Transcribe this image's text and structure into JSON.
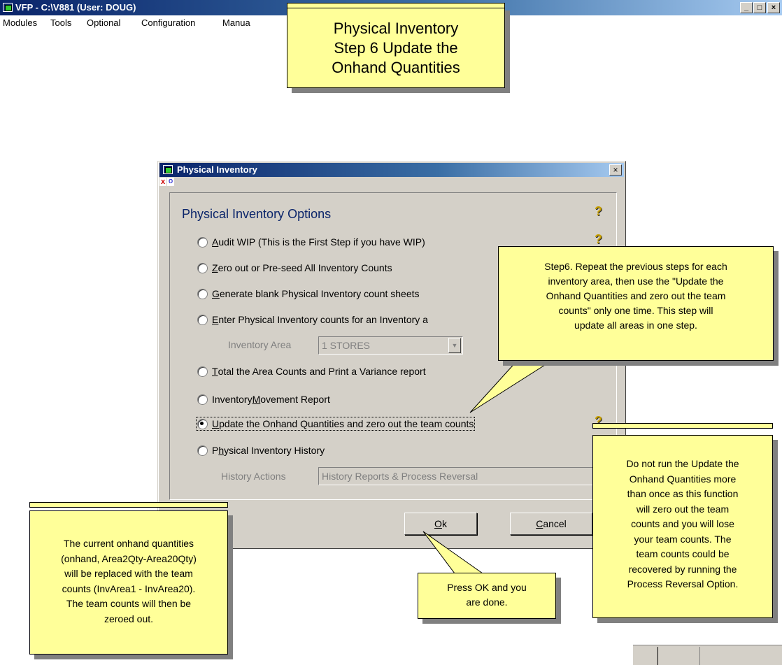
{
  "main_window": {
    "title": "VFP - C:\\V881  (User: DOUG)",
    "controls": [
      "_",
      "□",
      "×"
    ]
  },
  "menu": [
    "Modules",
    "Tools",
    "Optional",
    "Configuration",
    "Manua"
  ],
  "title_callout": {
    "line1": "Physical Inventory",
    "line2": "Step 6 Update the",
    "line3": "Onhand Quantities"
  },
  "dialog": {
    "title": "Physical Inventory",
    "close_label": "×",
    "toolbar": [
      "x",
      "o"
    ],
    "heading": "Physical Inventory Options",
    "help_glyph": "?",
    "options": [
      {
        "pre": "",
        "key": "A",
        "post": "udit WIP (This is the First Step if you have WIP)",
        "selected": false
      },
      {
        "pre": "",
        "key": "Z",
        "post": "ero out or Pre-seed All Inventory Counts",
        "selected": false
      },
      {
        "pre": "",
        "key": "G",
        "post": "enerate blank Physical Inventory count sheets",
        "selected": false
      },
      {
        "pre": "",
        "key": "E",
        "post": "nter Physical Inventory counts for an Inventory a",
        "selected": false
      },
      {
        "pre": "",
        "key": "T",
        "post": "otal the Area Counts and Print a Variance report",
        "selected": false
      },
      {
        "pre": "Inventory ",
        "key": "M",
        "post": "ovement Report",
        "selected": false
      },
      {
        "pre": "",
        "key": "U",
        "post": "pdate the Onhand Quantities and zero out the team counts",
        "selected": true
      },
      {
        "pre": "P",
        "key": "h",
        "post": "ysical Inventory History",
        "selected": false
      }
    ],
    "inventory_area": {
      "label": "Inventory Area",
      "value": "1  STORES"
    },
    "history_actions": {
      "label": "History Actions",
      "value": "History Reports & Process Reversal"
    },
    "ok": {
      "key": "O",
      "rest": "k"
    },
    "cancel": {
      "key": "C",
      "rest": "ancel"
    }
  },
  "callouts": {
    "step6": [
      "Step6. Repeat the previous steps for each",
      "inventory area, then use the \"Update the",
      "Onhand Quantities and zero out the team",
      "counts\" only one time. This step will",
      "update all areas in one step."
    ],
    "warning": [
      "Do not run the Update the",
      "Onhand Quantities more",
      "than once as this function",
      "will zero out the team",
      "counts and you will lose",
      "your team counts.  The",
      "team counts could be",
      "recovered by running the",
      "Process Reversal Option."
    ],
    "current": [
      "The current onhand quantities",
      "(onhand, Area2Qty-Area20Qty)",
      "will be replaced with the team",
      "counts (InvArea1 - InvArea20).",
      "The team counts will then be",
      "zeroed out."
    ],
    "ok_note": [
      "Press OK and you",
      "are done."
    ]
  }
}
